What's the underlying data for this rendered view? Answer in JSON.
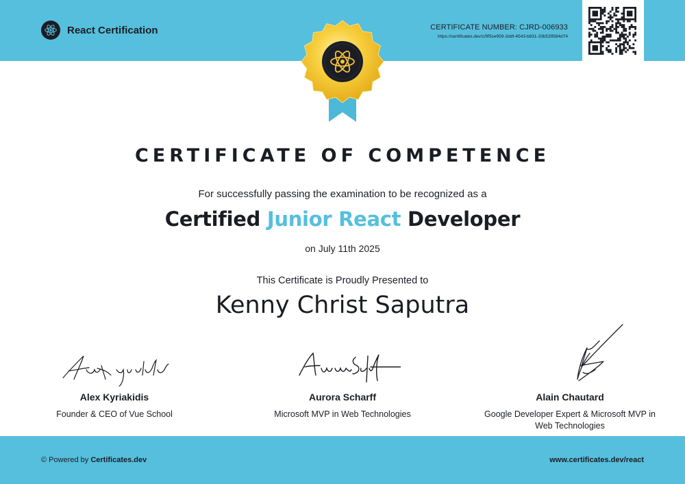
{
  "header": {
    "brand_name": "React Certification",
    "certificate_number": "CERTIFICATE NUMBER: CJRD-006933",
    "verify_url": "https://certificates.dev/c/9f5ce959-2ddf-4543-b831-33b539584d74"
  },
  "certificate": {
    "title": "CERTIFICATE OF COMPETENCE",
    "subtitle": "For successfully passing the examination to be recognized as a",
    "role_prefix": "Certified",
    "role_highlight": "Junior React",
    "role_suffix": "Developer",
    "date": "on July 11th 2025",
    "presented_to": "This Certificate is Proudly Presented to",
    "recipient": "Kenny Christ Saputra"
  },
  "signers": [
    {
      "name": "Alex Kyriakidis",
      "role": "Founder & CEO of Vue School"
    },
    {
      "name": "Aurora Scharff",
      "role": "Microsoft MVP in Web Technologies"
    },
    {
      "name": "Alain Chautard",
      "role": "Google Developer Expert & Microsoft MVP in Web Technologies"
    }
  ],
  "signature_images": [
    "Alex Kyriakidis",
    "Aurora Scharff"
  ],
  "footer": {
    "powered_prefix": "Powered by",
    "powered_brand": "Certificates.dev",
    "website": "www.certificates.dev/react"
  },
  "colors": {
    "accent": "#56bfdd",
    "text": "#1b1d24",
    "badge_gold": "#f2c12e"
  },
  "icons": {
    "brand": "react-atom-icon",
    "badge": "gold-rosette-badge-icon",
    "qr": "qr-code-icon",
    "powered": "copyright-icon"
  }
}
